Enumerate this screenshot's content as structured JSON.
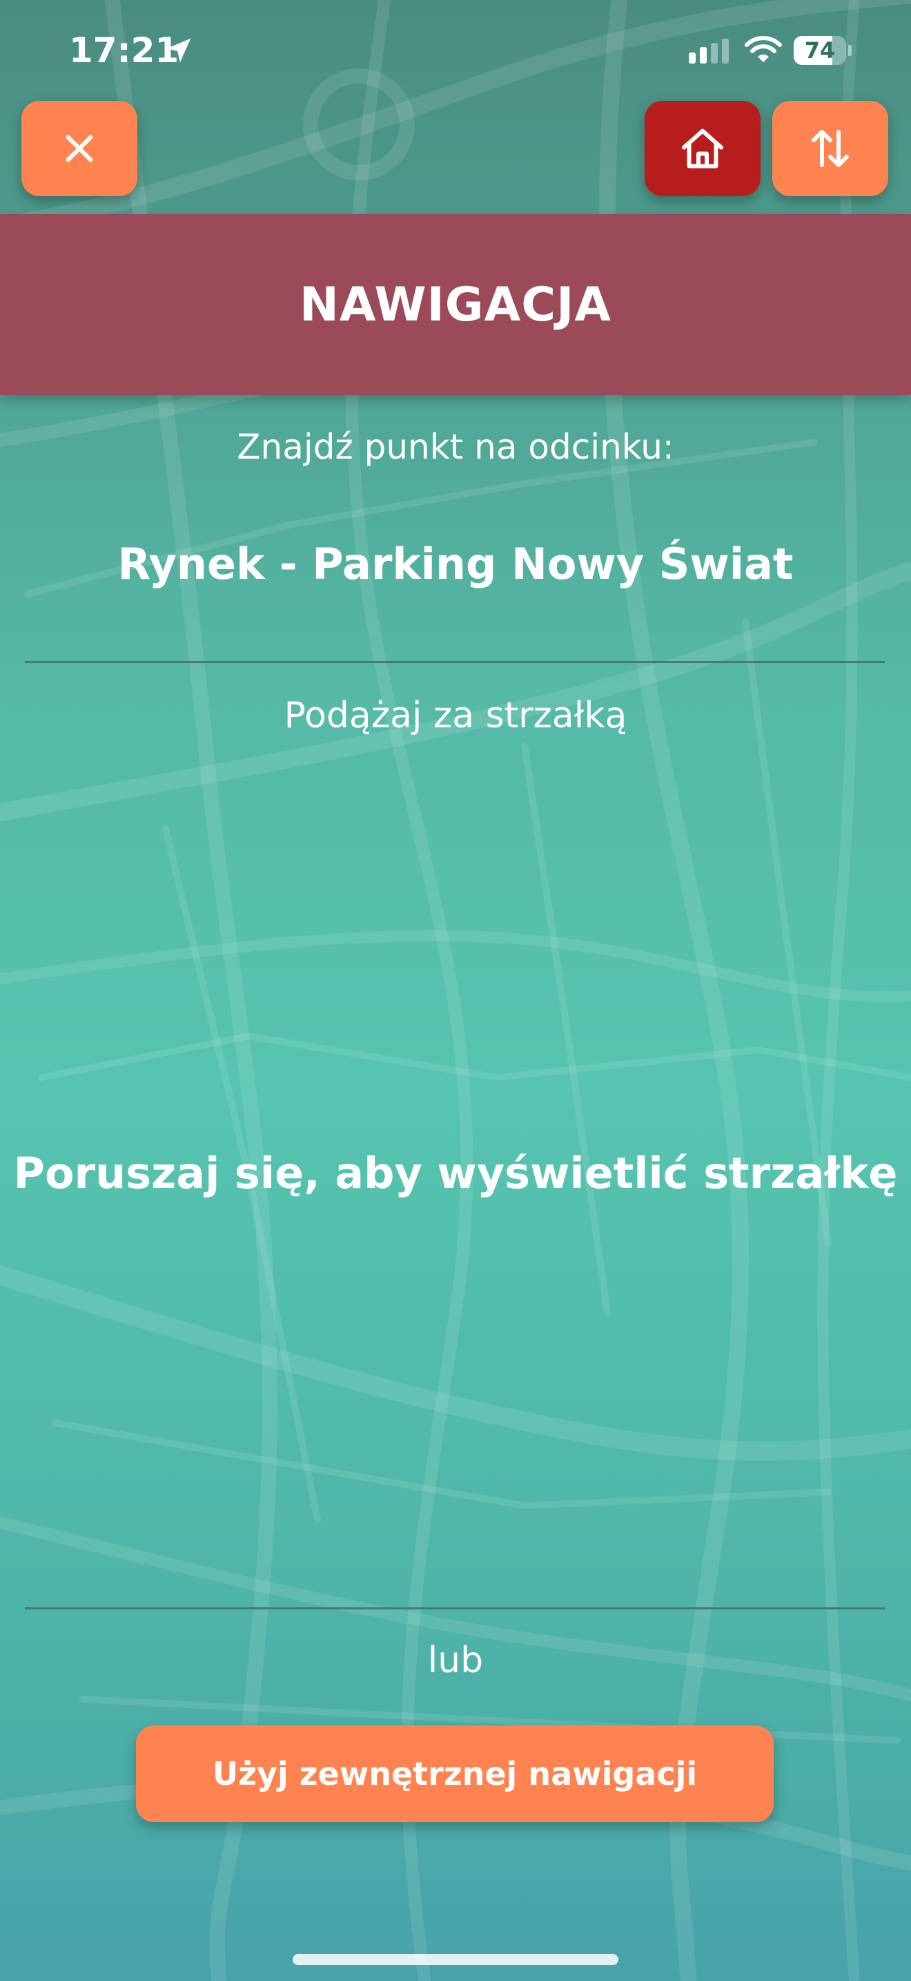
{
  "status_bar": {
    "time": "17:21",
    "battery_level": "74",
    "battery_fraction": 0.74,
    "icons": [
      "location-arrow-icon",
      "cellular-signal-icon",
      "wifi-icon",
      "battery-icon"
    ]
  },
  "toolbar": {
    "close_icon": "close-icon",
    "home_icon": "home-icon",
    "swap_icon": "swap-vertical-icon"
  },
  "header": {
    "title": "NAWIGACJA"
  },
  "main": {
    "find_point_label": "Znajdź punkt na odcinku:",
    "route_name": "Rynek - Parking Nowy Świat",
    "follow_arrow_label": "Podążaj za strzałką",
    "move_prompt": "Poruszaj się, aby wyświetlić strzałkę",
    "or_label": "lub",
    "external_nav_label": "Użyj zewnętrznej nawigacji"
  },
  "colors": {
    "accent_orange": "#ff8350",
    "home_red": "#b81d1d",
    "header_rose": "#9b4a5a",
    "background_teal": "#55b9a6"
  }
}
